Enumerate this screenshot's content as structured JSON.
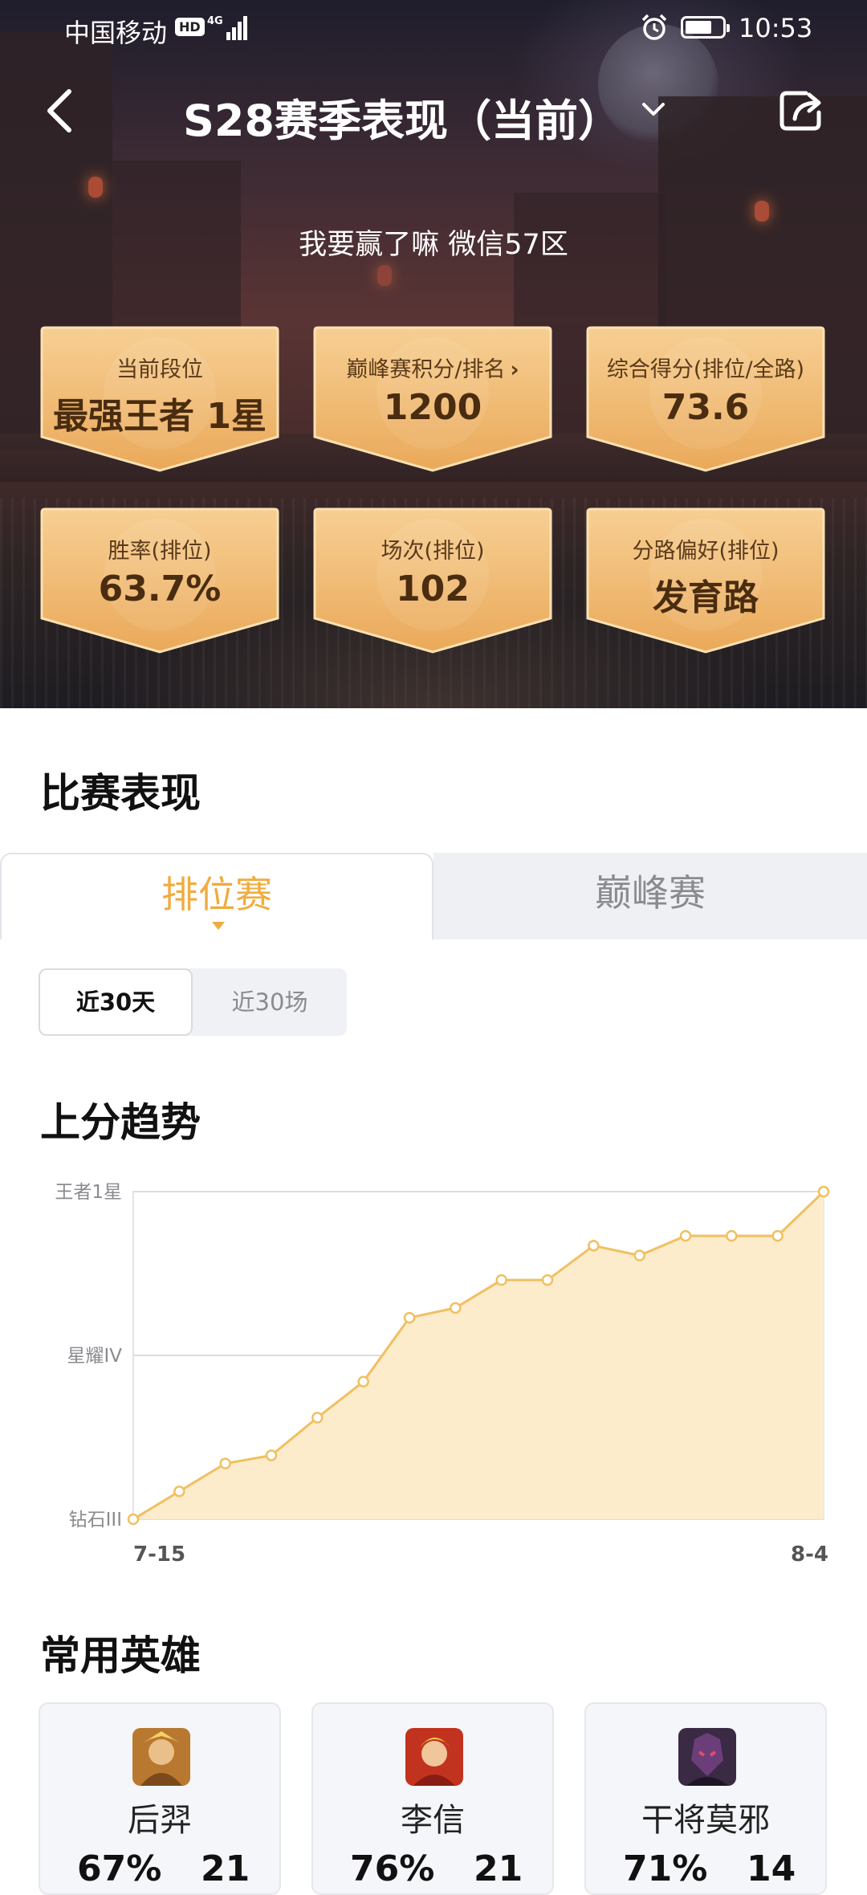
{
  "status_bar": {
    "carrier": "中国移动",
    "hd": "HD",
    "network": "4G",
    "time": "10:53"
  },
  "header": {
    "title": "S28赛季表现（当前）",
    "user": "我要赢了嘛  微信57区"
  },
  "stats": [
    {
      "label": "当前段位",
      "value": "最强王者 1星"
    },
    {
      "label": "巅峰赛积分/排名",
      "value": "1200",
      "arrow": "›"
    },
    {
      "label": "综合得分(排位/全路)",
      "value": "73.6"
    },
    {
      "label": "胜率(排位)",
      "value": "63.7%"
    },
    {
      "label": "场次(排位)",
      "value": "102"
    },
    {
      "label": "分路偏好(排位)",
      "value": "发育路"
    }
  ],
  "section_match": {
    "title": "比赛表现"
  },
  "tabs": {
    "ranked": "排位赛",
    "peak": "巅峰赛"
  },
  "segment": {
    "last30days": "近30天",
    "last30games": "近30场"
  },
  "section_trend": {
    "title": "上分趋势"
  },
  "chart_data": {
    "type": "area",
    "y_tick_labels": [
      "钻石III",
      "星耀IV",
      "王者1星"
    ],
    "x_tick_labels": [
      "7-15",
      "8-4"
    ],
    "x": [
      0,
      1,
      2,
      3,
      4,
      5,
      6,
      7,
      8,
      9,
      10,
      11,
      12,
      13,
      14,
      15
    ],
    "values": [
      0,
      0.17,
      0.34,
      0.39,
      0.62,
      0.84,
      1.23,
      1.29,
      1.46,
      1.46,
      1.67,
      1.61,
      1.73,
      1.73,
      1.73,
      2.0
    ],
    "ylim": [
      0,
      2
    ],
    "grid": true,
    "color": "#f0c060",
    "fill": "#fcebc9"
  },
  "section_heroes": {
    "title": "常用英雄"
  },
  "heroes": [
    {
      "name": "后羿",
      "winrate": "67%",
      "games": "21"
    },
    {
      "name": "李信",
      "winrate": "76%",
      "games": "21"
    },
    {
      "name": "干将莫邪",
      "winrate": "71%",
      "games": "14"
    }
  ],
  "colors": {
    "accent": "#f1ab3e",
    "card_gold": "#f2bf7e"
  }
}
